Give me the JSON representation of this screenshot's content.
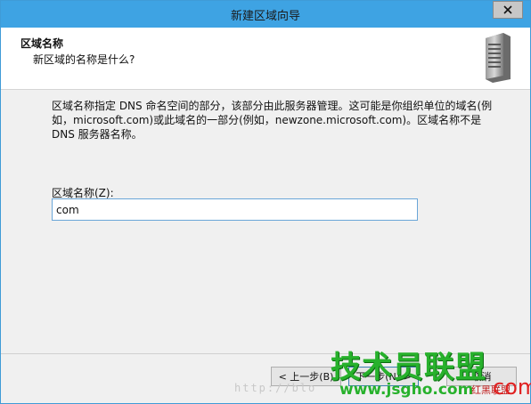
{
  "window": {
    "title": "新建区域向导",
    "close_icon": "close-icon",
    "accent": "#3ea3e3"
  },
  "header": {
    "title": "区域名称",
    "subtitle": "新区域的名称是什么?",
    "icon": "server-icon"
  },
  "body": {
    "description": "区域名称指定 DNS 命名空间的部分，该部分由此服务器管理。这可能是你组织单位的域名(例如，microsoft.com)或此域名的一部分(例如，newzone.microsoft.com)。区域名称不是 DNS 服务器名称。",
    "zone_name_label": "区域名称(Z):",
    "zone_name_value": "com"
  },
  "buttons": {
    "back": "< 上一步(B)",
    "next": "下一步(N) >",
    "cancel": "取消"
  },
  "watermark": {
    "brand_cn": "技术员联盟",
    "url": "www.jsgho.com",
    "com": "com",
    "small": "红黑联盟",
    "http": "http://blo"
  }
}
